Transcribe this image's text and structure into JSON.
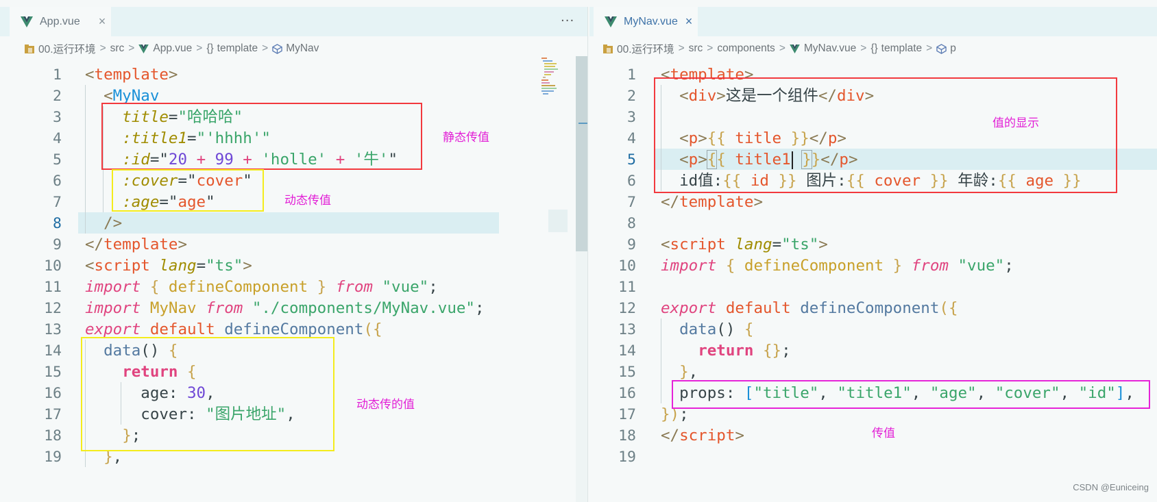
{
  "left_editor": {
    "tab": {
      "title": "App.vue",
      "close": "×"
    },
    "more": "···",
    "breadcrumb": [
      "00.运行环境",
      "src",
      "App.vue",
      "template",
      "MyNav"
    ],
    "line_numbers": [
      "1",
      "2",
      "3",
      "4",
      "5",
      "6",
      "7",
      "8",
      "9",
      "10",
      "11",
      "12",
      "13",
      "14",
      "15",
      "16",
      "17",
      "18",
      "19"
    ],
    "annotations": {
      "static": "静态传值",
      "dynamic": "动态传值",
      "dynamic_values": "动态传的值"
    }
  },
  "right_editor": {
    "tab": {
      "title": "MyNav.vue",
      "close": "×"
    },
    "breadcrumb": [
      "00.运行环境",
      "src",
      "components",
      "MyNav.vue",
      "template",
      "p"
    ],
    "line_numbers": [
      "1",
      "2",
      "3",
      "4",
      "5",
      "6",
      "7",
      "8",
      "9",
      "10",
      "11",
      "12",
      "13",
      "14",
      "15",
      "16",
      "17",
      "18",
      "19"
    ],
    "annotations": {
      "display": "值的显示",
      "pass": "传值"
    }
  },
  "watermark": "CSDN @Euniceing",
  "colors": {
    "red_box": "#f2393e",
    "yellow_box": "#f4ec1c",
    "magenta_box": "#e623d8",
    "annotation_text": "#e21fd6"
  }
}
